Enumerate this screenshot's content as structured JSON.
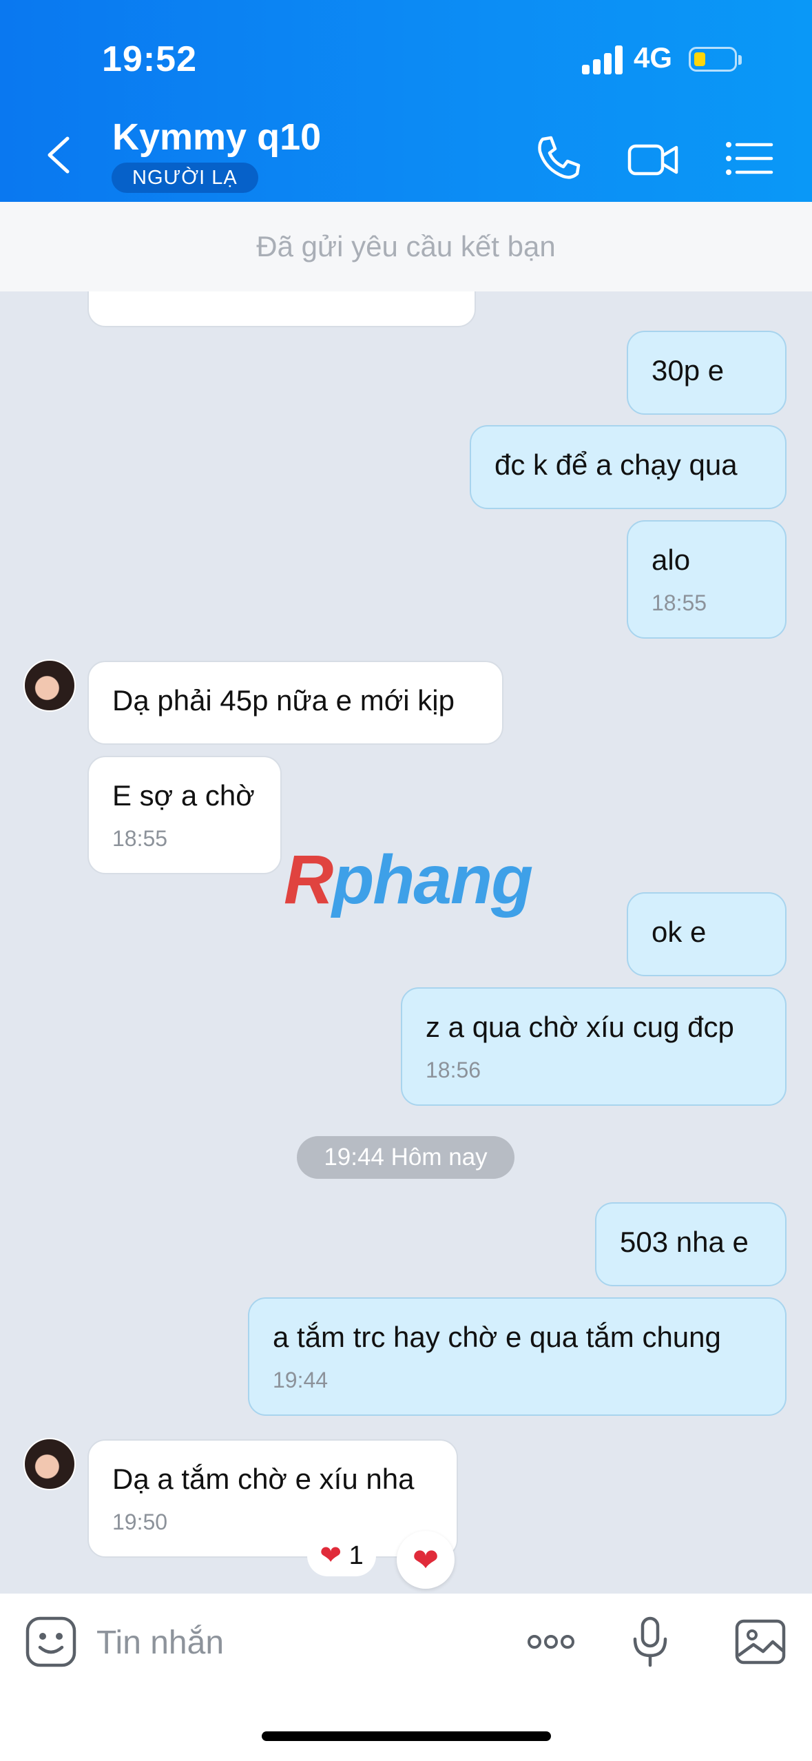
{
  "status": {
    "time": "19:52",
    "network": "4G"
  },
  "header": {
    "contact_name": "Kymmy q10",
    "badge": "NGƯỜI LẠ"
  },
  "friend_request": {
    "text": "Đã gửi yêu cầu kết bạn"
  },
  "messages": [
    {
      "dir": "out",
      "text": "30p e",
      "time": ""
    },
    {
      "dir": "out",
      "text": "đc k để a chạy qua",
      "time": ""
    },
    {
      "dir": "out",
      "text": "alo",
      "time": "18:55"
    },
    {
      "dir": "in",
      "text": "Dạ phải 45p nữa e mới kịp",
      "time": ""
    },
    {
      "dir": "in",
      "text": "E sợ a chờ",
      "time": "18:55"
    },
    {
      "dir": "out",
      "text": "ok e",
      "time": ""
    },
    {
      "dir": "out",
      "text": "z a qua chờ xíu cug đcp",
      "time": "18:56"
    },
    {
      "dir": "out",
      "text": "503 nha e",
      "time": ""
    },
    {
      "dir": "out",
      "text": "a tắm trc hay chờ e qua tắm chung",
      "time": "19:44"
    },
    {
      "dir": "in",
      "text": "Dạ a tắm chờ e xíu nha",
      "time": "19:50"
    }
  ],
  "day_separator": "19:44 Hôm nay",
  "watermark": {
    "first": "R",
    "rest": "phang"
  },
  "reaction": {
    "emoji": "❤",
    "count": "1",
    "button": "❤"
  },
  "input": {
    "placeholder": "Tin nhắn"
  },
  "colors": {
    "header": "#0a78f0",
    "badge": "#0661c9",
    "bubble_out": "#d4effd",
    "bubble_in": "#ffffff",
    "chat_bg": "#e2e7ef"
  }
}
